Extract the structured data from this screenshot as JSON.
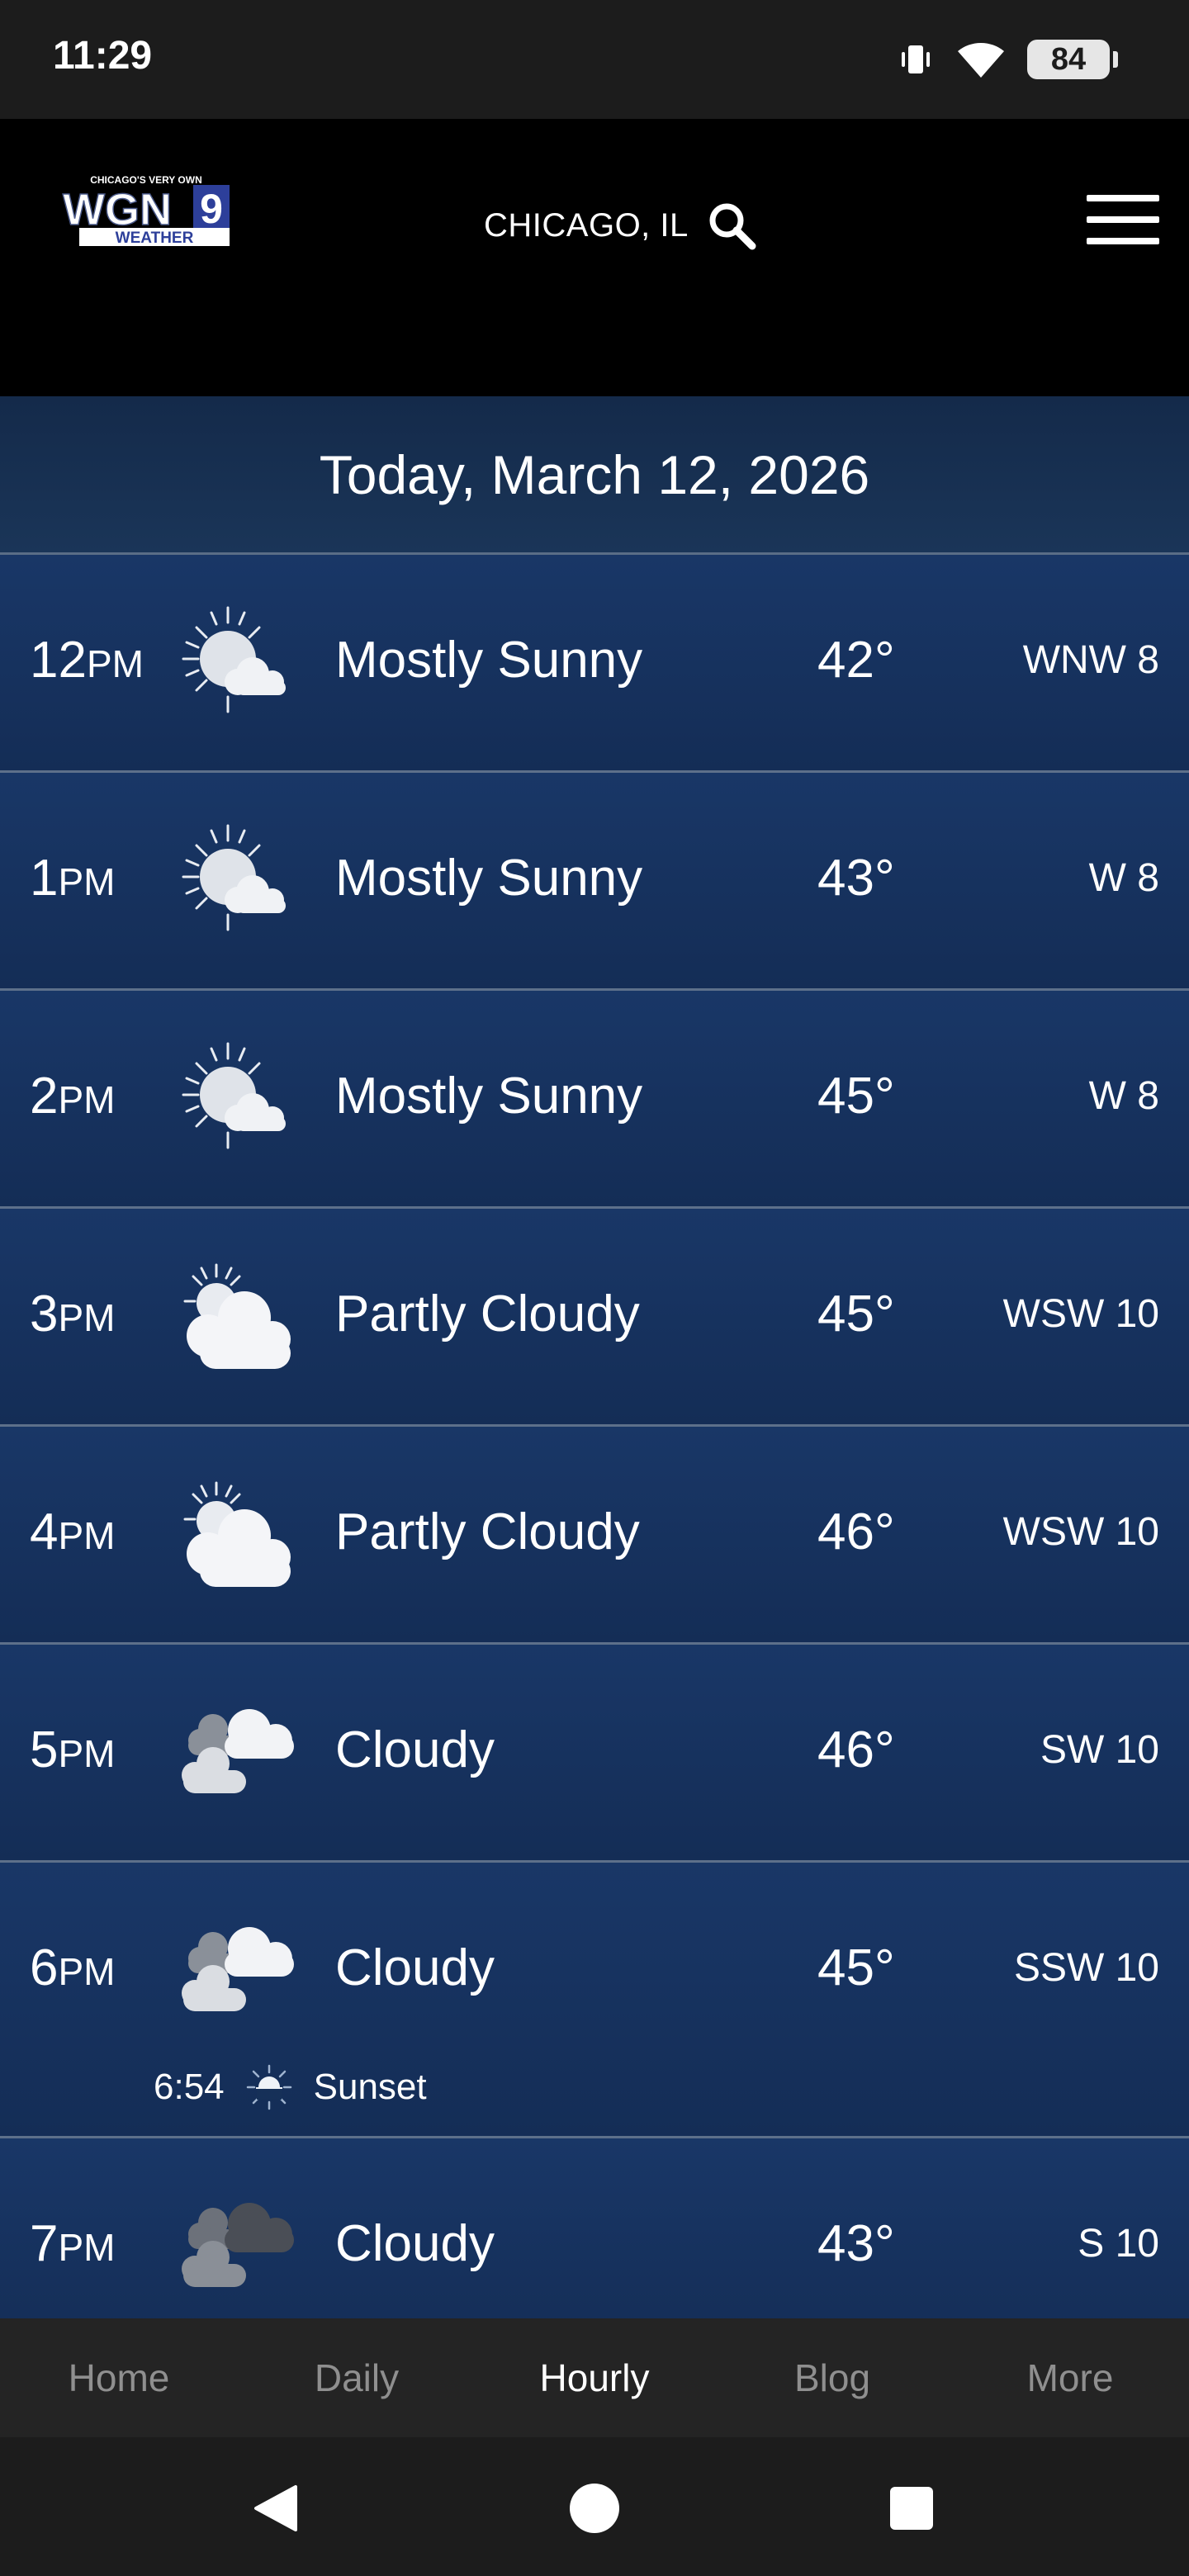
{
  "status_bar": {
    "time": "11:29",
    "battery": "84"
  },
  "header": {
    "logo": {
      "tagline": "CHICAGO'S VERY OWN",
      "brand": "WGN",
      "channel": "9",
      "sub": "WEATHER"
    },
    "location": "CHICAGO, IL"
  },
  "date": "Today, March 12, 2026",
  "hours": [
    {
      "hour": "12",
      "suffix": "PM",
      "icon": "mostly-sunny-icon",
      "condition": "Mostly Sunny",
      "temp": "42°",
      "wind": "WNW 8"
    },
    {
      "hour": "1",
      "suffix": "PM",
      "icon": "mostly-sunny-icon",
      "condition": "Mostly Sunny",
      "temp": "43°",
      "wind": "W 8"
    },
    {
      "hour": "2",
      "suffix": "PM",
      "icon": "mostly-sunny-icon",
      "condition": "Mostly Sunny",
      "temp": "45°",
      "wind": "W 8"
    },
    {
      "hour": "3",
      "suffix": "PM",
      "icon": "partly-cloudy-icon",
      "condition": "Partly Cloudy",
      "temp": "45°",
      "wind": "WSW 10"
    },
    {
      "hour": "4",
      "suffix": "PM",
      "icon": "partly-cloudy-icon",
      "condition": "Partly Cloudy",
      "temp": "46°",
      "wind": "WSW 10"
    },
    {
      "hour": "5",
      "suffix": "PM",
      "icon": "cloudy-icon",
      "condition": "Cloudy",
      "temp": "46°",
      "wind": "SW 10"
    },
    {
      "hour": "6",
      "suffix": "PM",
      "icon": "cloudy-icon",
      "condition": "Cloudy",
      "temp": "45°",
      "wind": "SSW 10"
    },
    {
      "hour": "7",
      "suffix": "PM",
      "icon": "cloudy-dark-icon",
      "condition": "Cloudy",
      "temp": "43°",
      "wind": "S 10"
    }
  ],
  "sunset": {
    "time": "6:54",
    "label": "Sunset"
  },
  "bottom_nav": [
    "Home",
    "Daily",
    "Hourly",
    "Blog",
    "More"
  ],
  "bottom_nav_active": "Hourly",
  "colors": {
    "row_bg": "#193767",
    "date_bar_bg": "#142a4a",
    "divider": "#5d708a",
    "nav_inactive": "#8f8f8f"
  }
}
